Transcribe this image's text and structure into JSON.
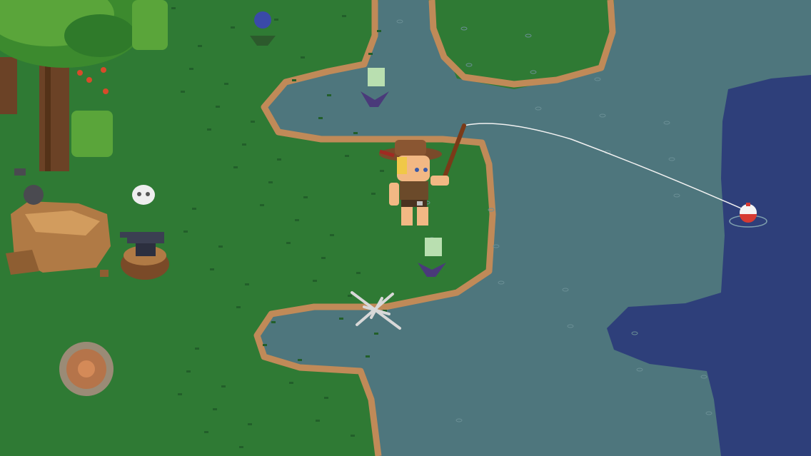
{
  "scene": {
    "title": "",
    "description_hidden": false
  },
  "colors": {
    "grass": "#2f7a34",
    "grass_dark": "#225f2a",
    "grass_light": "#4f9a3c",
    "shallow_water": "#4e767d",
    "deep_water": "#2e3f7a",
    "shore_dirt": "#c08a58",
    "shore_foam": "#33b7e0",
    "trunk": "#6b4226",
    "rock": "#b07a45",
    "anvil": "#3b3f52"
  },
  "sprites": {
    "player": "fisherman-with-hat",
    "rod": "fishing-rod",
    "bobber": "fishing-bobber",
    "tree": "oak-tree",
    "boulder": "boulder",
    "anvil": "anvil-on-stump",
    "campfire": "campfire-pit",
    "skull": "skull",
    "bones": "bone-pile",
    "flower_blue": "blue-flower",
    "flower_white": "white-flower"
  }
}
